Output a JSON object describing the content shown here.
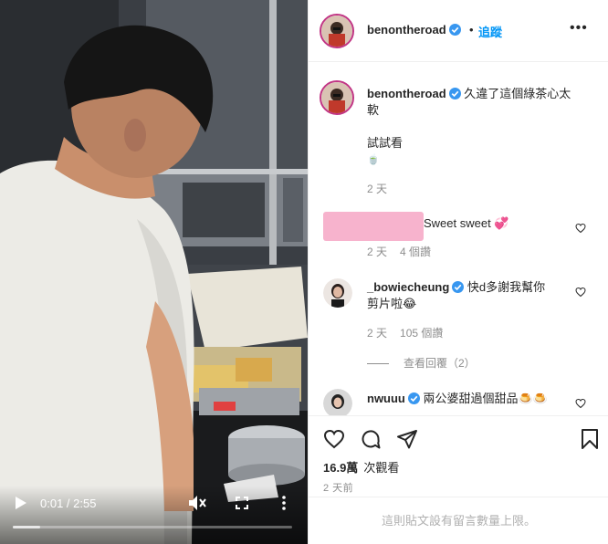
{
  "video": {
    "play_icon": "play-icon",
    "current_time": "0:01",
    "duration": "2:55",
    "time_separator": " / ",
    "progress": 0.01,
    "mute_icon": "muted-speaker-icon",
    "fullscreen_icon": "fullscreen-icon",
    "more_icon": "more-vertical-icon"
  },
  "header": {
    "username": "benontheroad",
    "verified": true,
    "separator": "•",
    "follow_label": "追蹤",
    "options": "•••"
  },
  "caption": {
    "username": "benontheroad",
    "text_line1": "久違了這個綠茶心太",
    "text_line2": "軟",
    "text_line3": "試試看",
    "emoji": "🍵",
    "time": "2 天"
  },
  "comments": [
    {
      "username_redacted": true,
      "text": "Sweet sweet 💞",
      "time": "2 天",
      "likes": "4 個讚"
    },
    {
      "username": "_bowiecheung",
      "verified": true,
      "text_line1": "快d多謝我幫你",
      "text_line2": "剪片啦😂",
      "time": "2 天",
      "likes": "105 個讚",
      "view_replies": "查看回覆（2）"
    },
    {
      "username": "nwuuu",
      "verified": true,
      "text": "兩公婆甜過個甜品🍮🍮"
    }
  ],
  "footer": {
    "views_count": "16.9萬",
    "views_label": "次觀看",
    "time": "2 天前",
    "comments_closed": "這則貼文設有留言數量上限。"
  },
  "colors": {
    "accent_blue": "#0095f6",
    "verified_blue": "#3897f0",
    "redaction_pink": "#f7b3cd"
  }
}
